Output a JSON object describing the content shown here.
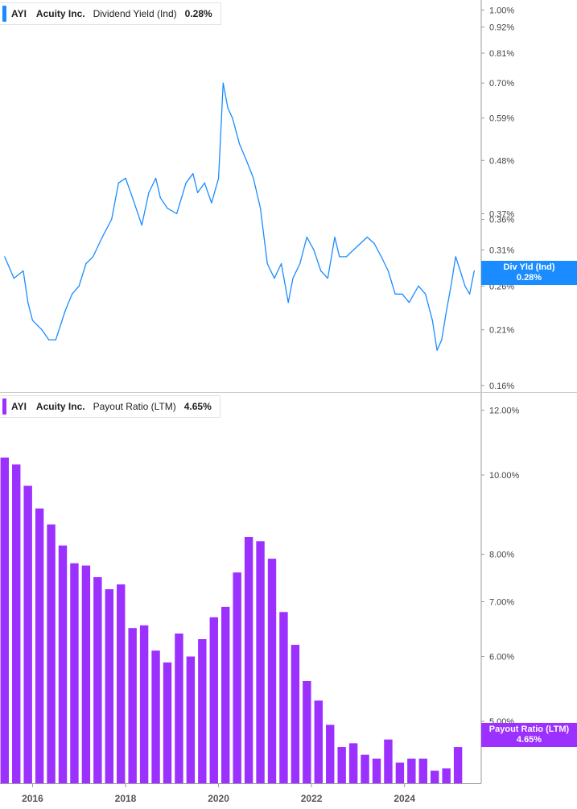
{
  "chart_data": [
    {
      "type": "line",
      "legend": {
        "ticker": "AYI",
        "company": "Acuity Inc.",
        "metric": "Dividend Yield (Ind)",
        "value": "0.28%"
      },
      "series": [
        {
          "name": "Div Yld (Ind)",
          "color": "#1a8cff"
        }
      ],
      "current_label": {
        "title": "Div Yld (Ind)",
        "value": "0.28%"
      },
      "y_scale": "log",
      "ylim": [
        0.155,
        1.05
      ],
      "yticks": [
        {
          "label": "1.00%",
          "value": 1.0
        },
        {
          "label": "0.92%",
          "value": 0.92
        },
        {
          "label": "0.81%",
          "value": 0.81
        },
        {
          "label": "0.70%",
          "value": 0.7
        },
        {
          "label": "0.59%",
          "value": 0.59
        },
        {
          "label": "0.48%",
          "value": 0.48
        },
        {
          "label": "0.37%",
          "value": 0.37
        },
        {
          "label": "0.36%",
          "value": 0.36
        },
        {
          "label": "0.31%",
          "value": 0.31
        },
        {
          "label": "0.26%",
          "value": 0.26
        },
        {
          "label": "0.21%",
          "value": 0.21
        },
        {
          "label": "0.16%",
          "value": 0.16
        }
      ],
      "x": [
        2015.4,
        2015.6,
        2015.8,
        2015.9,
        2016.0,
        2016.2,
        2016.35,
        2016.5,
        2016.7,
        2016.85,
        2017.0,
        2017.15,
        2017.3,
        2017.5,
        2017.7,
        2017.85,
        2018.0,
        2018.15,
        2018.35,
        2018.5,
        2018.65,
        2018.75,
        2018.9,
        2019.1,
        2019.3,
        2019.45,
        2019.55,
        2019.7,
        2019.85,
        2020.0,
        2020.1,
        2020.2,
        2020.3,
        2020.45,
        2020.6,
        2020.75,
        2020.9,
        2021.05,
        2021.2,
        2021.35,
        2021.5,
        2021.6,
        2021.75,
        2021.9,
        2022.05,
        2022.2,
        2022.35,
        2022.5,
        2022.6,
        2022.75,
        2022.9,
        2023.05,
        2023.2,
        2023.35,
        2023.5,
        2023.65,
        2023.8,
        2023.95,
        2024.1,
        2024.3,
        2024.45,
        2024.6,
        2024.7,
        2024.8,
        2024.9,
        2025.0,
        2025.1,
        2025.2,
        2025.3,
        2025.4,
        2025.5
      ],
      "values": [
        0.3,
        0.27,
        0.28,
        0.24,
        0.22,
        0.21,
        0.2,
        0.2,
        0.23,
        0.25,
        0.26,
        0.29,
        0.3,
        0.33,
        0.36,
        0.43,
        0.44,
        0.4,
        0.35,
        0.41,
        0.44,
        0.4,
        0.38,
        0.37,
        0.43,
        0.45,
        0.41,
        0.43,
        0.39,
        0.44,
        0.7,
        0.62,
        0.59,
        0.52,
        0.48,
        0.44,
        0.38,
        0.29,
        0.27,
        0.29,
        0.24,
        0.27,
        0.29,
        0.33,
        0.31,
        0.28,
        0.27,
        0.33,
        0.3,
        0.3,
        0.31,
        0.32,
        0.33,
        0.32,
        0.3,
        0.28,
        0.25,
        0.25,
        0.24,
        0.26,
        0.25,
        0.22,
        0.19,
        0.2,
        0.23,
        0.26,
        0.3,
        0.28,
        0.26,
        0.25,
        0.28
      ],
      "x_range": [
        2015.3,
        2025.65
      ]
    },
    {
      "type": "bar",
      "legend": {
        "ticker": "AYI",
        "company": "Acuity Inc.",
        "metric": "Payout Ratio (LTM)",
        "value": "4.65%"
      },
      "series": [
        {
          "name": "Payout Ratio (LTM)",
          "color": "#9b30ff"
        }
      ],
      "current_label": {
        "title": "Payout Ratio (LTM)",
        "value": "4.65%"
      },
      "y_scale": "log",
      "ylim": [
        4.2,
        12.6
      ],
      "yticks": [
        {
          "label": "12.00%",
          "value": 12.0
        },
        {
          "label": "10.00%",
          "value": 10.0
        },
        {
          "label": "8.00%",
          "value": 8.0
        },
        {
          "label": "7.00%",
          "value": 7.0
        },
        {
          "label": "6.00%",
          "value": 6.0
        },
        {
          "label": "5.00%",
          "value": 5.0
        }
      ],
      "xticks": [
        "2016",
        "2018",
        "2020",
        "2022",
        "2024"
      ],
      "xtick_values": [
        2016,
        2018,
        2020,
        2022,
        2024
      ],
      "x": [
        2015.4,
        2015.65,
        2015.9,
        2016.15,
        2016.4,
        2016.65,
        2016.9,
        2017.15,
        2017.4,
        2017.65,
        2017.9,
        2018.15,
        2018.4,
        2018.65,
        2018.9,
        2019.15,
        2019.4,
        2019.65,
        2019.9,
        2020.15,
        2020.4,
        2020.65,
        2020.9,
        2021.15,
        2021.4,
        2021.65,
        2021.9,
        2022.15,
        2022.4,
        2022.65,
        2022.9,
        2023.15,
        2023.4,
        2023.65,
        2023.9,
        2024.15,
        2024.4,
        2024.65,
        2024.9,
        2025.15
      ],
      "values": [
        10.5,
        10.3,
        9.7,
        9.1,
        8.7,
        8.2,
        7.8,
        7.75,
        7.5,
        7.25,
        7.35,
        6.5,
        6.55,
        6.1,
        5.9,
        6.4,
        6.0,
        6.3,
        6.7,
        6.9,
        7.6,
        8.4,
        8.3,
        7.9,
        6.8,
        6.2,
        5.6,
        5.3,
        4.95,
        4.65,
        4.7,
        4.55,
        4.5,
        4.75,
        4.45,
        4.5,
        4.5,
        4.35,
        4.38,
        4.65
      ],
      "x_range": [
        2015.3,
        2025.65
      ]
    }
  ]
}
